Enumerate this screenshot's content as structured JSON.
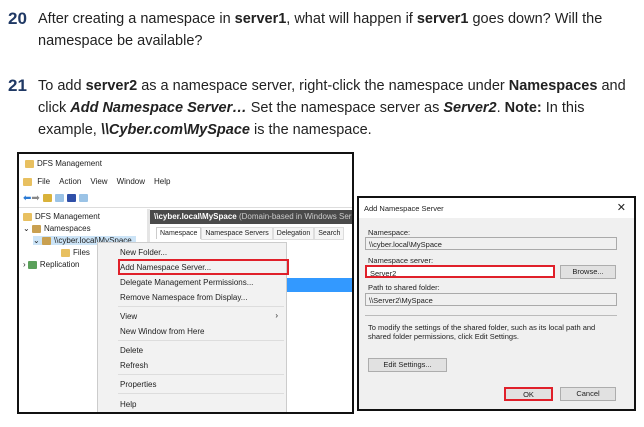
{
  "questions": [
    {
      "number": "20",
      "parts": [
        "After creating a namespace in ",
        "server1",
        ", what will happen if ",
        "server1",
        " goes down? Will the namespace be available?"
      ]
    },
    {
      "number": "21",
      "parts": [
        "To add ",
        "server2",
        " as a namespace server, right-click the namespace under ",
        "Namespaces",
        " and click ",
        "Add Namespace Server…",
        " Set the namespace server as ",
        "Server2",
        ". ",
        "Note:",
        " In this example, ",
        "\\\\Cyber.com\\MySpace",
        " is the namespace."
      ]
    }
  ],
  "mmc": {
    "title": "DFS Management",
    "menu": [
      "File",
      "Action",
      "View",
      "Window",
      "Help"
    ],
    "tree": {
      "root": "DFS Management",
      "namespaces": "Namespaces",
      "namespace": "\\\\cyber.local\\MySpace",
      "files": "Files",
      "replication": "Replication"
    },
    "header": {
      "path": "\\\\cyber.local\\MySpace",
      "type": "(Domain-based in Windows Ser"
    },
    "tabs": [
      "Namespace",
      "Namespace Servers",
      "Delegation",
      "Search"
    ],
    "context_menu": [
      "New Folder...",
      "Add Namespace Server...",
      "Delegate Management Permissions...",
      "Remove Namespace from Display...",
      "View",
      "New Window from Here",
      "Delete",
      "Refresh",
      "Properties",
      "Help"
    ]
  },
  "dialog": {
    "title": "Add Namespace Server",
    "namespace_label": "Namespace:",
    "namespace_value": "\\\\cyber.local\\MySpace",
    "server_label": "Namespace server:",
    "server_value": "Server2",
    "browse": "Browse...",
    "path_label": "Path to shared folder:",
    "path_value": "\\\\Server2\\MySpace",
    "info": "To modify the settings of the shared folder, such as its local path and shared folder permissions, click Edit Settings.",
    "edit_settings": "Edit Settings...",
    "ok": "OK",
    "cancel": "Cancel"
  },
  "colors": {
    "highlight": "#e0202a",
    "selection": "#3399ff",
    "number": "#1f3864"
  }
}
